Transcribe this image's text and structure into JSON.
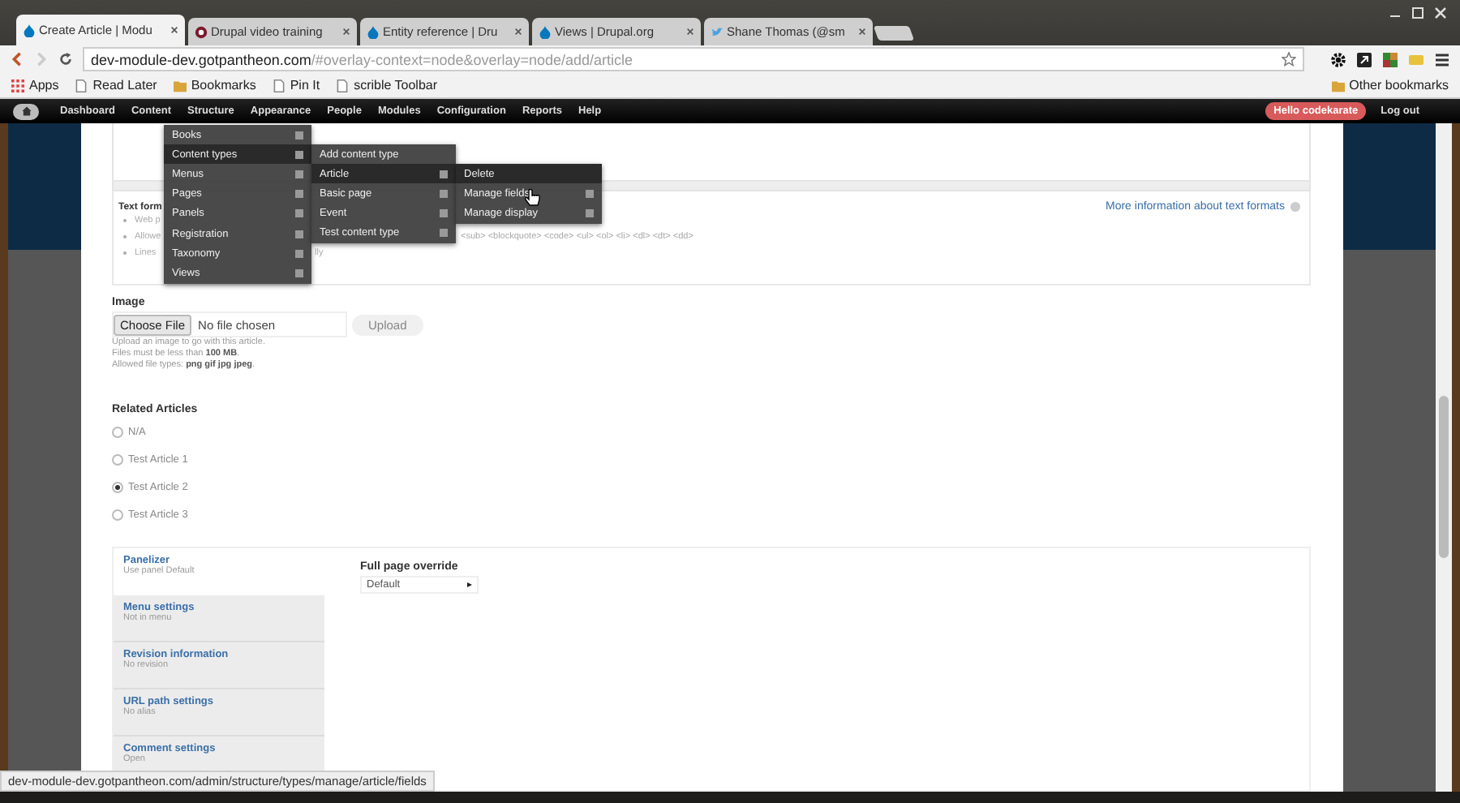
{
  "browser": {
    "tabs": [
      {
        "title": "Create Article | Modu",
        "selected": true,
        "kind": "drop"
      },
      {
        "title": "Drupal video training",
        "selected": false,
        "kind": "circle"
      },
      {
        "title": "Entity reference | Dru",
        "selected": false,
        "kind": "drop"
      },
      {
        "title": "Views | Drupal.org",
        "selected": false,
        "kind": "drop"
      },
      {
        "title": "Shane Thomas (@sm",
        "selected": false,
        "kind": "bird"
      }
    ],
    "address": {
      "host": "dev-module-dev.gotpantheon.com",
      "path": "/#overlay-context=node&overlay=node/add/article"
    },
    "bookmarks": [
      {
        "label": "Apps",
        "kind": "apps"
      },
      {
        "label": "Read Later",
        "kind": "page"
      },
      {
        "label": "Bookmarks",
        "kind": "folder"
      },
      {
        "label": "Pin It",
        "kind": "page"
      },
      {
        "label": "scrible Toolbar",
        "kind": "page"
      }
    ],
    "other_bookmarks": "Other bookmarks"
  },
  "toolbar": {
    "items": [
      "Dashboard",
      "Content",
      "Structure",
      "Appearance",
      "People",
      "Modules",
      "Configuration",
      "Reports",
      "Help"
    ],
    "user": "Hello codekarate",
    "logout": "Log out"
  },
  "menus": [
    {
      "items": [
        {
          "label": "Books",
          "selected": false,
          "expandable": true
        },
        {
          "label": "Content types",
          "selected": true,
          "expandable": true
        },
        {
          "label": "Menus",
          "selected": false,
          "expandable": true
        },
        {
          "label": "Pages",
          "selected": false,
          "expandable": true
        },
        {
          "label": "Panels",
          "selected": false,
          "expandable": true
        },
        {
          "label": "Registration",
          "selected": false,
          "expandable": true
        },
        {
          "label": "Taxonomy",
          "selected": false,
          "expandable": true
        },
        {
          "label": "Views",
          "selected": false,
          "expandable": true
        }
      ]
    },
    {
      "items": [
        {
          "label": "Add content type",
          "selected": false,
          "expandable": false
        },
        {
          "label": "Article",
          "selected": true,
          "expandable": true
        },
        {
          "label": "Basic page",
          "selected": false,
          "expandable": true
        },
        {
          "label": "Event",
          "selected": false,
          "expandable": true
        },
        {
          "label": "Test content type",
          "selected": false,
          "expandable": true
        }
      ]
    },
    {
      "items": [
        {
          "label": "Delete",
          "selected": true,
          "expandable": false
        },
        {
          "label": "Manage fields",
          "selected": false,
          "expandable": true
        },
        {
          "label": "Manage display",
          "selected": false,
          "expandable": true
        }
      ]
    }
  ],
  "format_help": {
    "title": "Text form",
    "more_link": "More information about text formats",
    "lines": [
      {
        "start": "Web p"
      },
      {
        "start": "Allowe",
        "end": "<sub> <blockquote> <code> <ul> <ol> <li> <dl> <dt> <dd>"
      },
      {
        "start": "Lines",
        "end": "lly"
      }
    ]
  },
  "image": {
    "label": "Image",
    "choose": "Choose File",
    "file_status": "No file chosen",
    "upload": "Upload",
    "help": [
      "Upload an image to go with this article.",
      "Files must be less than **100 MB**.",
      "Allowed file types: **png gif jpg jpeg**."
    ]
  },
  "related": {
    "label": "Related Articles",
    "options": [
      {
        "label": "N/A",
        "selected": false
      },
      {
        "label": "Test Article 1",
        "selected": false
      },
      {
        "label": "Test Article 2",
        "selected": true
      },
      {
        "label": "Test Article 3",
        "selected": false
      }
    ]
  },
  "vertical_tabs": [
    {
      "title": "Panelizer",
      "summary": "Use panel Default",
      "selected": true
    },
    {
      "title": "Menu settings",
      "summary": "Not in menu",
      "selected": false
    },
    {
      "title": "Revision information",
      "summary": "No revision",
      "selected": false
    },
    {
      "title": "URL path settings",
      "summary": "No alias",
      "selected": false
    },
    {
      "title": "Comment settings",
      "summary": "Open",
      "selected": false
    }
  ],
  "panel": {
    "label": "Full page override",
    "value": "Default"
  },
  "status_url": "dev-module-dev.gotpantheon.com/admin/structure/types/manage/article/fields"
}
